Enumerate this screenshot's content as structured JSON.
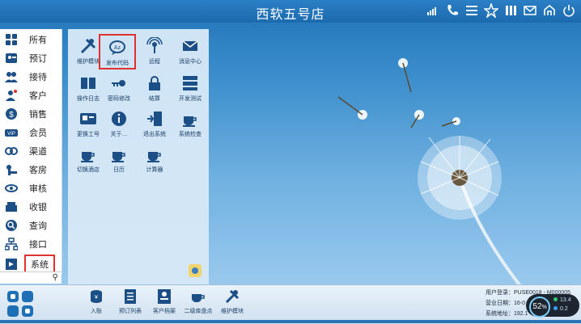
{
  "window": {
    "title": "西软五号店"
  },
  "titlebar_icons": [
    "signal-icon",
    "phone-icon",
    "menu-icon",
    "star-icon",
    "columns-icon",
    "mail-icon",
    "switch-user-icon",
    "power-icon"
  ],
  "sidebar": {
    "items": [
      {
        "label": "所有",
        "icon": "all-icon"
      },
      {
        "label": "预订",
        "icon": "reservation-icon"
      },
      {
        "label": "接待",
        "icon": "reception-icon"
      },
      {
        "label": "客户",
        "icon": "customer-icon"
      },
      {
        "label": "销售",
        "icon": "sales-icon"
      },
      {
        "label": "会员",
        "icon": "vip-icon"
      },
      {
        "label": "渠道",
        "icon": "channel-icon"
      },
      {
        "label": "客房",
        "icon": "room-icon"
      },
      {
        "label": "审核",
        "icon": "audit-icon"
      },
      {
        "label": "收银",
        "icon": "cashier-icon"
      },
      {
        "label": "查询",
        "icon": "search-icon"
      },
      {
        "label": "接口",
        "icon": "interface-icon"
      },
      {
        "label": "系统",
        "icon": "system-icon"
      }
    ],
    "selected": "系统"
  },
  "panel": {
    "items": [
      {
        "label": "维护模块",
        "icon": "tools-icon"
      },
      {
        "label": "发布代码",
        "icon": "chat-bubble-icon"
      },
      {
        "label": "远程",
        "icon": "remote-icon"
      },
      {
        "label": "消息中心",
        "icon": "mail-icon"
      },
      {
        "label": "操作日志",
        "icon": "book-icon"
      },
      {
        "label": "密码修改",
        "icon": "key-icon"
      },
      {
        "label": "结算",
        "icon": "lock-icon"
      },
      {
        "label": "开发测试",
        "icon": "server-icon"
      },
      {
        "label": "更换工号",
        "icon": "id-card-icon"
      },
      {
        "label": "关于…",
        "icon": "info-icon"
      },
      {
        "label": "退出系统",
        "icon": "exit-icon"
      },
      {
        "label": "系统检查",
        "icon": "cup-icon"
      },
      {
        "label": "切换酒店",
        "icon": "cup-icon"
      },
      {
        "label": "日历",
        "icon": "cup-icon"
      },
      {
        "label": "计算器",
        "icon": "cup-icon"
      }
    ],
    "highlighted": "发布代码"
  },
  "taskbar": {
    "items": [
      {
        "label": "入账",
        "icon": "coins-icon"
      },
      {
        "label": "预订列表",
        "icon": "list-icon"
      },
      {
        "label": "客户档案",
        "icon": "profile-icon"
      },
      {
        "label": "二级库盘点",
        "icon": "cup-icon"
      },
      {
        "label": "维护模块",
        "icon": "tools-icon"
      }
    ]
  },
  "status": {
    "user_label": "用户登录：PUSE0018 - M000005",
    "date_label": "营业日期：16-0",
    "address_label": "系统地址：192.1",
    "meter_percent": "52",
    "meter_unit": "%",
    "upload": "13.4",
    "download": "0.2"
  },
  "colors": {
    "accent": "#1b6aae",
    "highlight_border": "#e03030"
  }
}
